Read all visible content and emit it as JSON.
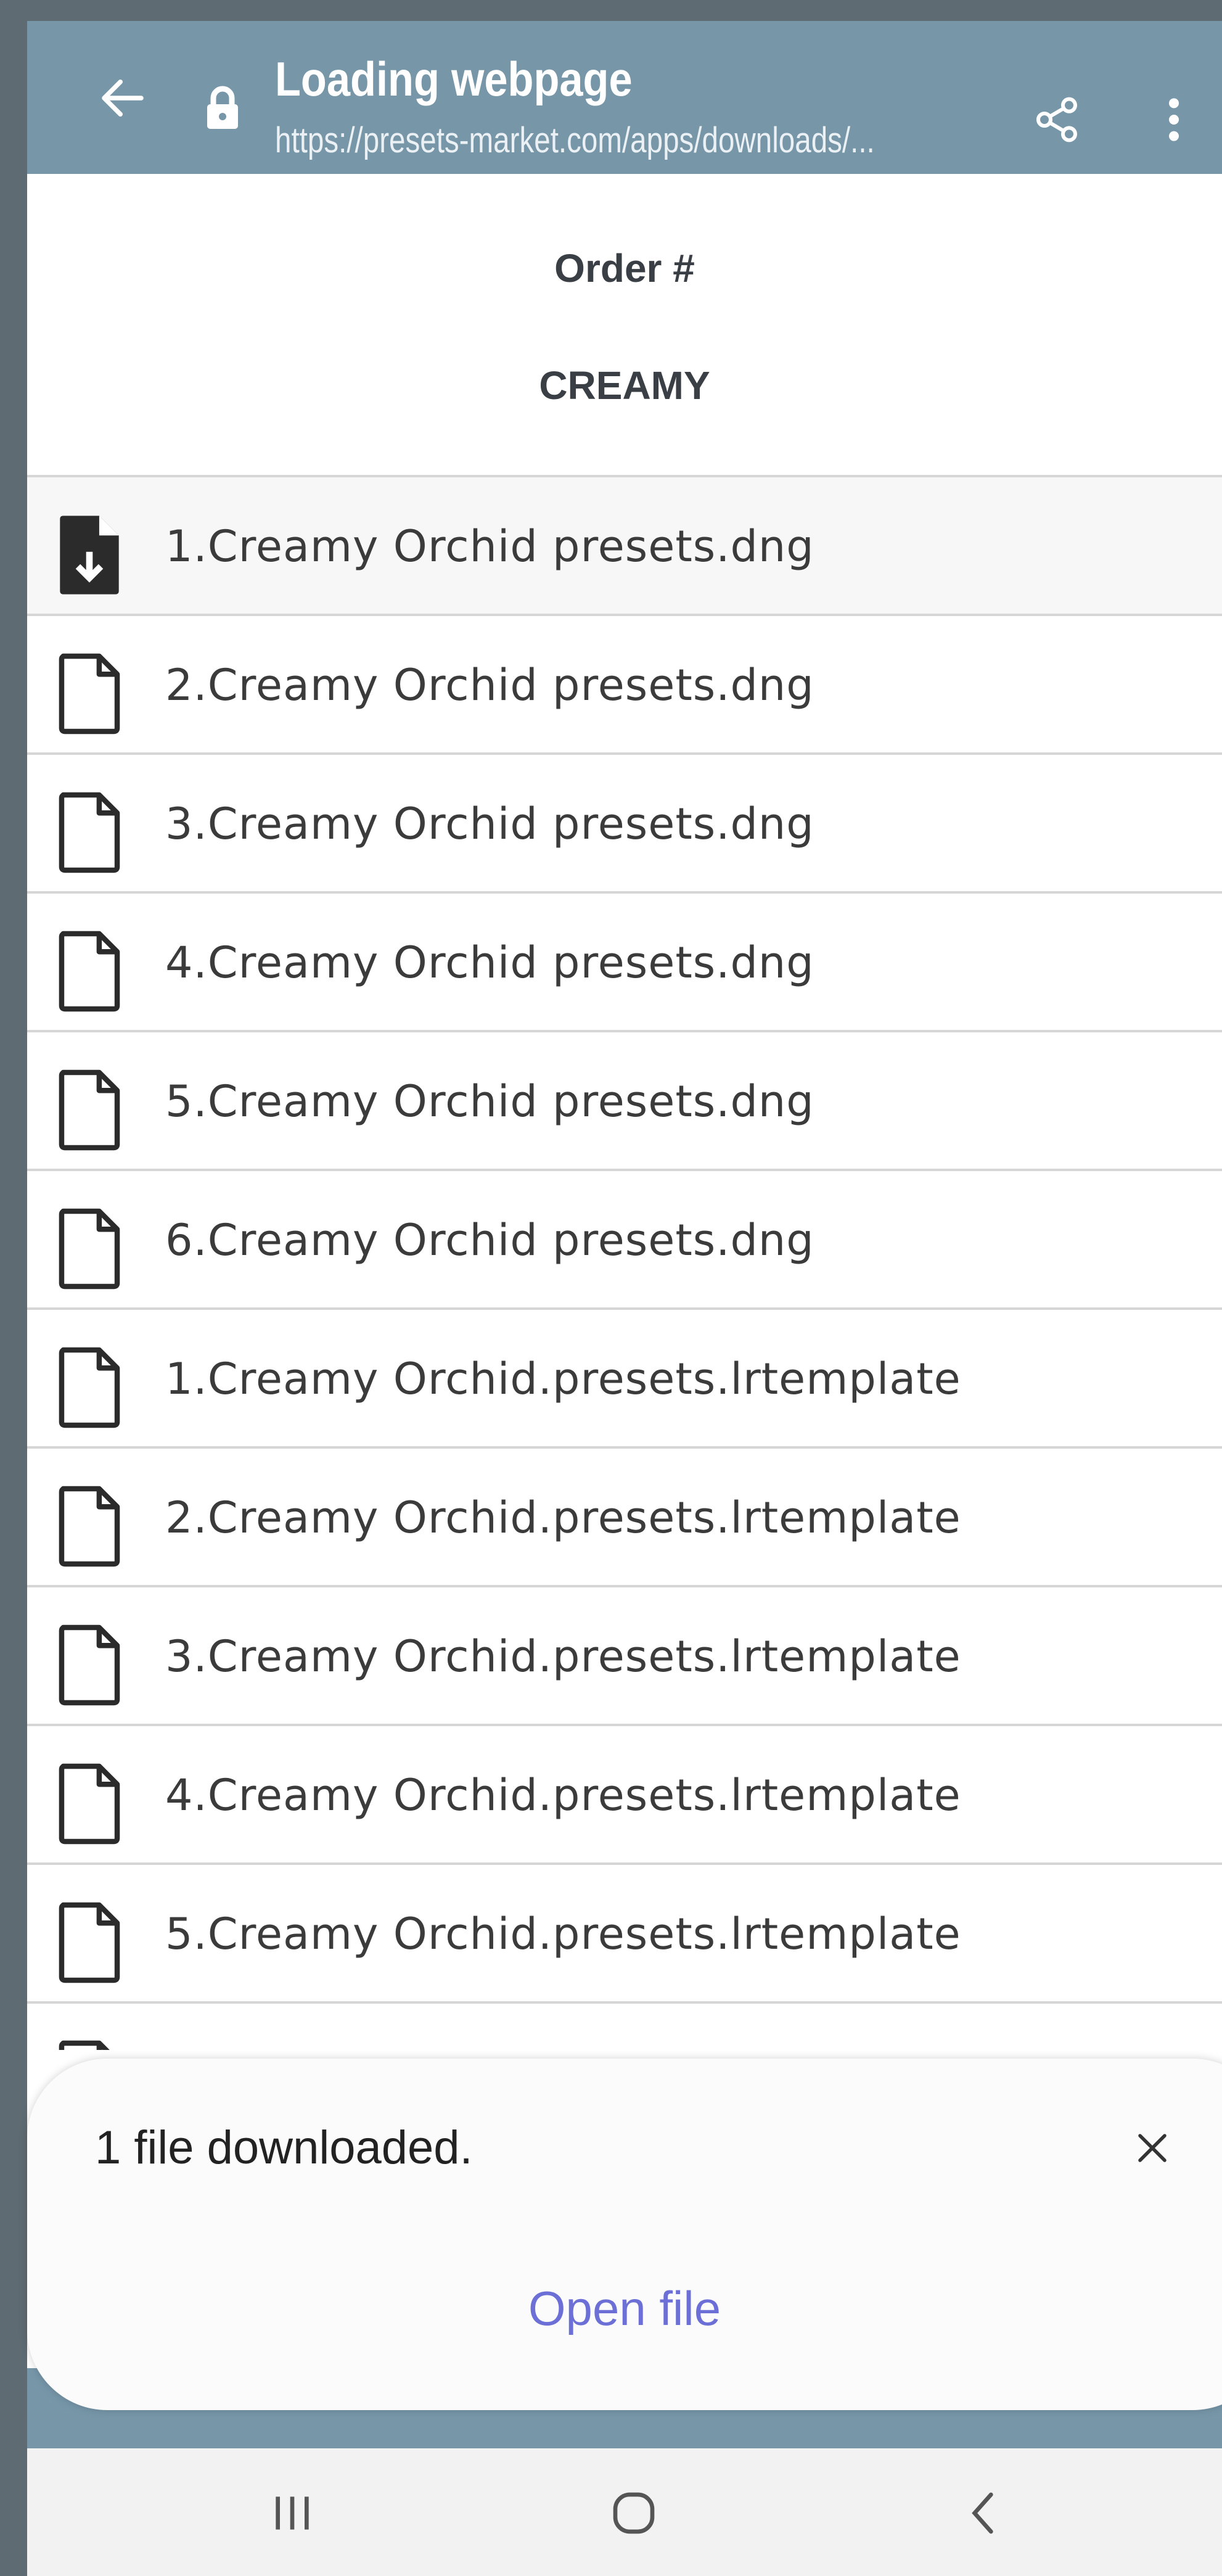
{
  "browser": {
    "title": "Loading webpage",
    "url": "https://presets-market.com/apps/downloads/...",
    "icons": {
      "back": "arrow-left-icon",
      "lock": "lock-icon",
      "share": "share-icon",
      "more": "more-vertical-icon"
    },
    "toolbar_color": "#7797a9"
  },
  "order": {
    "label": "Order #",
    "name": "CREAMY"
  },
  "files": [
    {
      "name": "1.Creamy Orchid presets.dng",
      "icon": "file-download-icon",
      "downloaded": true
    },
    {
      "name": "2.Creamy Orchid presets.dng",
      "icon": "file-icon"
    },
    {
      "name": "3.Creamy Orchid presets.dng",
      "icon": "file-icon"
    },
    {
      "name": "4.Creamy Orchid presets.dng",
      "icon": "file-icon"
    },
    {
      "name": "5.Creamy Orchid presets.dng",
      "icon": "file-icon"
    },
    {
      "name": "6.Creamy Orchid presets.dng",
      "icon": "file-icon"
    },
    {
      "name": "1.Creamy Orchid.presets.lrtemplate",
      "icon": "file-icon"
    },
    {
      "name": "2.Creamy Orchid.presets.lrtemplate",
      "icon": "file-icon"
    },
    {
      "name": "3.Creamy Orchid.presets.lrtemplate",
      "icon": "file-icon"
    },
    {
      "name": "4.Creamy Orchid.presets.lrtemplate",
      "icon": "file-icon"
    },
    {
      "name": "5.Creamy Orchid.presets.lrtemplate",
      "icon": "file-icon"
    }
  ],
  "toast": {
    "message": "1 file downloaded.",
    "action": "Open file",
    "close_icon": "close-icon",
    "action_color": "#6b6fd6"
  },
  "navbar": {
    "icons": [
      "recent-apps-icon",
      "home-icon",
      "back-icon"
    ]
  }
}
